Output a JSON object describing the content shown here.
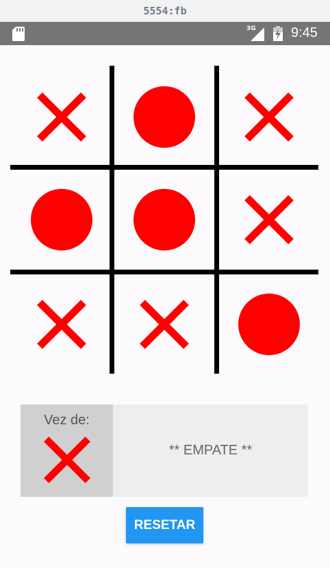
{
  "window": {
    "title": "5554:fb"
  },
  "statusbar": {
    "network": "3G",
    "time": "9:45",
    "icons": [
      "sd-card-icon",
      "signal-icon",
      "battery-charging-icon"
    ]
  },
  "board": {
    "cells": [
      "X",
      "O",
      "X",
      "O",
      "O",
      "X",
      "X",
      "X",
      "O"
    ]
  },
  "turn": {
    "label": "Vez de:",
    "player": "X"
  },
  "status": {
    "text": "** EMPATE **"
  },
  "actions": {
    "reset_label": "RESETAR"
  },
  "colors": {
    "mark": "#FF0000",
    "grid": "#000000",
    "button": "#2196F3",
    "statusbar": "#757575"
  }
}
